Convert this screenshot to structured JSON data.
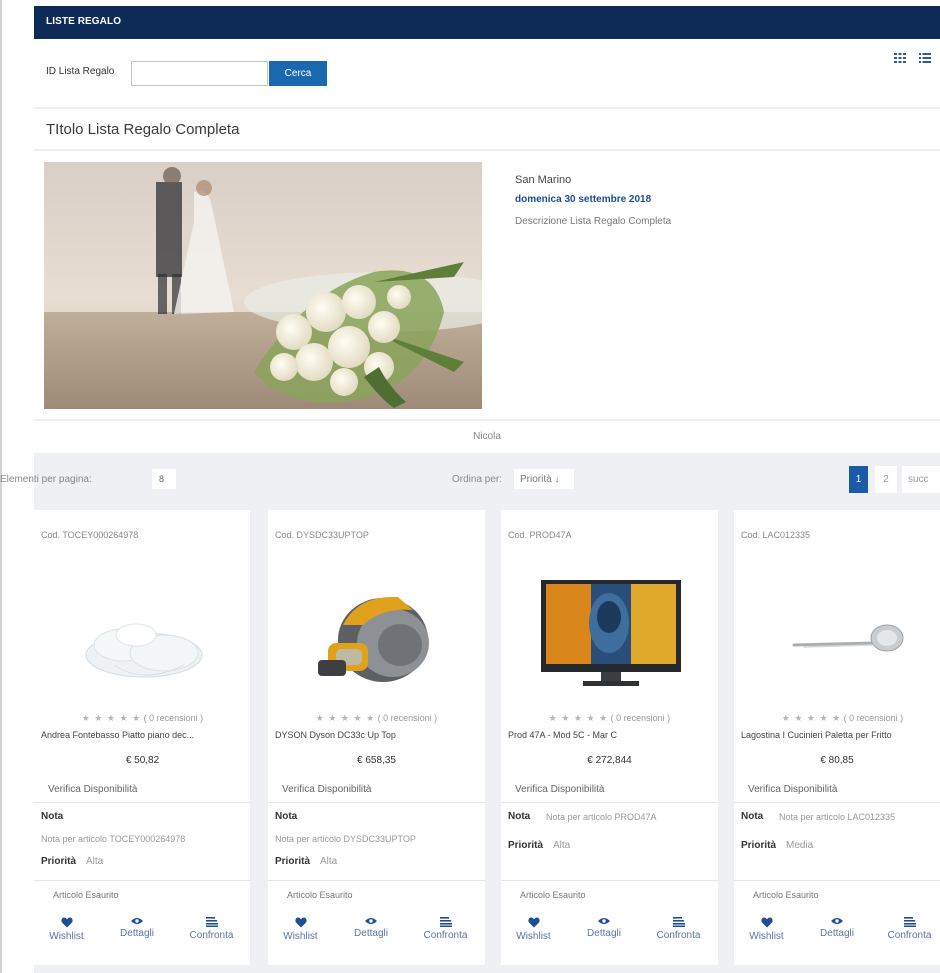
{
  "header": {
    "title": "LISTE REGALO"
  },
  "search": {
    "label": "ID Lista Regalo",
    "value": "",
    "button": "Cerca"
  },
  "icons": {
    "grid": "grid-view-icon",
    "list": "list-view-icon"
  },
  "list": {
    "title": "TItolo Lista Regalo Completa",
    "location": "San Marino",
    "date": "domenica 30 settembre 2018",
    "description": "Descrizione Lista Regalo Completa",
    "owner": "Nicola"
  },
  "toolbar": {
    "per_page_label": "Elementi per pagina:",
    "per_page_value": "8",
    "sort_label": "Ordina per:",
    "sort_value": "Priorità ↓",
    "pages": [
      "1",
      "2"
    ],
    "next": "succ"
  },
  "colors": {
    "header": "#0e2a56",
    "accent": "#1a68b0",
    "active_page": "#1a5aa6"
  },
  "products": [
    {
      "code": "Cod. TOCEY000264978",
      "stars": "★ ★ ★ ★ ★",
      "reviews": "( 0 recensioni )",
      "name": "Andrea Fontebasso Piatto piano dec...",
      "price": "€ 50,82",
      "availability": "Verifica Disponibilità",
      "note_label": "Nota",
      "note_text": "Nota per articolo TOCEY000264978",
      "priority_label": "Priorità",
      "priority_value": "Alta",
      "stock": "Articolo Esaurito",
      "wishlist": "Wishlist",
      "details": "Dettagli",
      "compare": "Confronta"
    },
    {
      "code": "Cod. DYSDC33UPTOP",
      "stars": "★ ★ ★ ★ ★",
      "reviews": "( 0 recensioni )",
      "name": "DYSON Dyson DC33c Up Top",
      "price": "€ 658,35",
      "availability": "Verifica Disponibilità",
      "note_label": "Nota",
      "note_text": "Nota per articolo DYSDC33UPTOP",
      "priority_label": "Priorità",
      "priority_value": "Alta",
      "stock": "Articolo Esaurito",
      "wishlist": "Wishlist",
      "details": "Dettagli",
      "compare": "Confronta"
    },
    {
      "code": "Cod. PROD47A",
      "stars": "★ ★ ★ ★ ★",
      "reviews": "( 0 recensioni )",
      "name": "Prod 47A - Mod 5C - Mar C",
      "price": "€ 272,844",
      "availability": "Verifica Disponibilità",
      "note_label": "Nota",
      "note_text": "Nota per articolo PROD47A",
      "priority_label": "Priorità",
      "priority_value": "Alta",
      "stock": "Articolo Esaurito",
      "wishlist": "Wishlist",
      "details": "Dettagli",
      "compare": "Confronta"
    },
    {
      "code": "Cod. LAC012335",
      "stars": "★ ★ ★ ★ ★",
      "reviews": "( 0 recensioni )",
      "name": "Lagostina I Cucinieri Paletta per Fritto",
      "price": "€ 80,85",
      "availability": "Verifica Disponibilità",
      "note_label": "Nota",
      "note_text": "Nota per articolo LAC012335",
      "priority_label": "Priorità",
      "priority_value": "Media",
      "stock": "Articolo Esaurito",
      "wishlist": "Wishlist",
      "details": "Dettagli",
      "compare": "Confronta"
    }
  ]
}
